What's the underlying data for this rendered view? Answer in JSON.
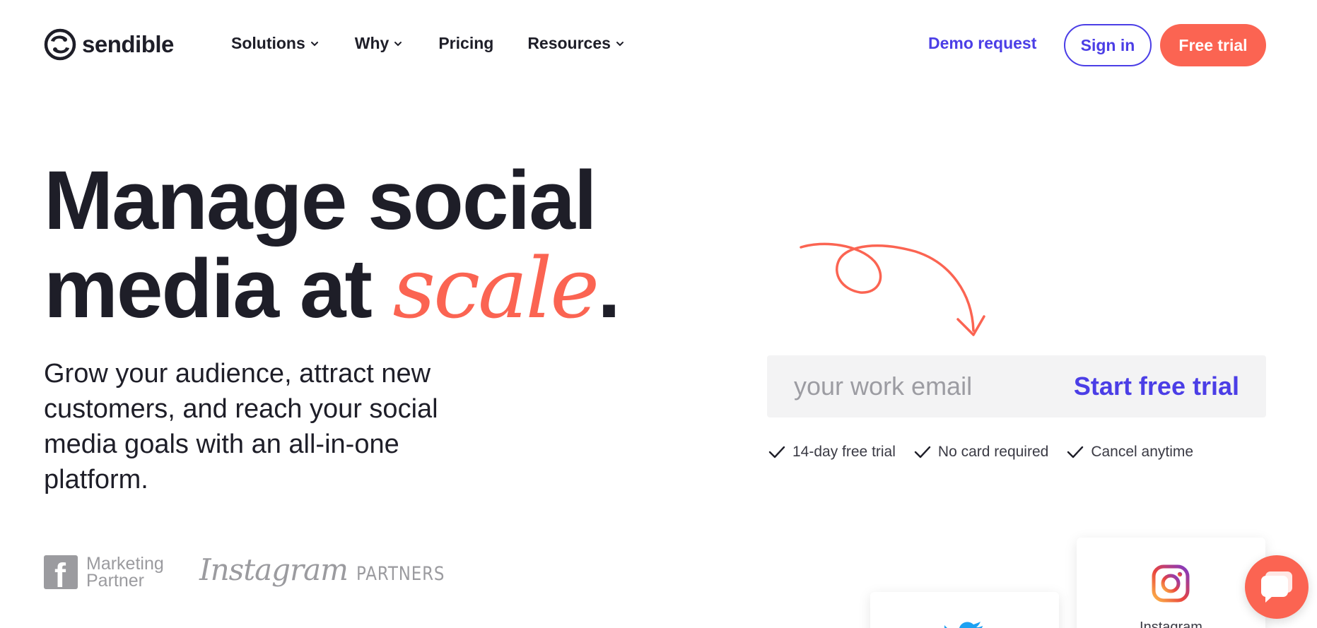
{
  "brand": {
    "name": "sendible"
  },
  "nav": {
    "solutions": "Solutions",
    "why": "Why",
    "pricing": "Pricing",
    "resources": "Resources"
  },
  "header_actions": {
    "demo": "Demo request",
    "sign_in": "Sign in",
    "free_trial": "Free trial"
  },
  "hero": {
    "line1": "Manage social",
    "line2_prefix": "media at ",
    "line2_accent": "scale",
    "line2_suffix": ".",
    "subhead": "Grow your audience, attract new customers, and reach your social media goals with an all-in-one platform."
  },
  "signup": {
    "email_placeholder": "your work email",
    "email_value": "",
    "cta": "Start free trial"
  },
  "perks": [
    "14-day free trial",
    "No card required",
    "Cancel anytime"
  ],
  "partners": {
    "facebook_line1": "Marketing",
    "facebook_line2": "Partner",
    "instagram_word": "Instagram",
    "instagram_suffix": "PARTNERS"
  },
  "cards": {
    "instagram_label": "Instagram"
  },
  "colors": {
    "accent_coral": "#fb6452",
    "accent_purple": "#4b3ee6",
    "text_dark": "#1e1e28",
    "muted_gray": "#9b9b9f",
    "input_bg": "#f3f3f4"
  },
  "icons": [
    "sendible-logo-icon",
    "chevron-down-icon",
    "arrow-doodle-icon",
    "check-icon",
    "facebook-icon",
    "twitter-icon",
    "instagram-icon",
    "chat-icon"
  ]
}
